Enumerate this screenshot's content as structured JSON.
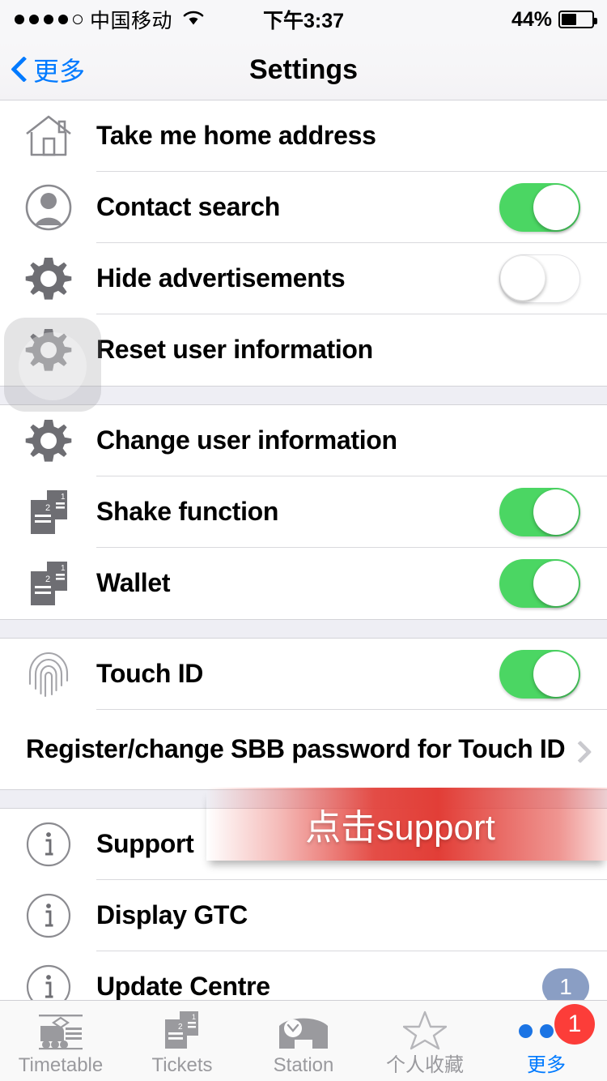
{
  "status_bar": {
    "signal_dots_filled": 4,
    "signal_dots_total": 5,
    "carrier": "中国移动",
    "wifi_icon": "wifi-icon",
    "time": "下午3:37",
    "battery_percent": "44%",
    "battery_level": 44
  },
  "nav": {
    "back_label": "更多",
    "back_icon": "chevron-left-icon",
    "title": "Settings"
  },
  "sections": [
    {
      "rows": [
        {
          "icon": "home-icon",
          "label": "Take me home address",
          "control": "none"
        },
        {
          "icon": "contact-icon",
          "label": "Contact search",
          "control": "toggle",
          "toggle_on": true
        },
        {
          "icon": "gear-icon",
          "label": "Hide advertisements",
          "control": "toggle",
          "toggle_on": false
        },
        {
          "icon": "gear-icon",
          "label": "Reset user information",
          "control": "none",
          "highlighted": true
        }
      ]
    },
    {
      "rows": [
        {
          "icon": "gear-icon",
          "label": "Change user information",
          "control": "none"
        },
        {
          "icon": "ticket-icon",
          "label": "Shake function",
          "control": "toggle",
          "toggle_on": true
        },
        {
          "icon": "ticket-icon",
          "label": "Wallet",
          "control": "toggle",
          "toggle_on": true
        }
      ]
    },
    {
      "rows": [
        {
          "icon": "fingerprint-icon",
          "label": "Touch ID",
          "control": "toggle",
          "toggle_on": true
        },
        {
          "icon": "none",
          "label": "Register/change SBB password for Touch ID",
          "control": "chevron"
        }
      ]
    },
    {
      "rows": [
        {
          "icon": "info-icon",
          "label": "Support",
          "control": "none"
        },
        {
          "icon": "info-icon",
          "label": "Display GTC",
          "control": "none"
        },
        {
          "icon": "info-icon",
          "label": "Update Centre",
          "control": "badge",
          "badge": "1"
        }
      ]
    }
  ],
  "annotation": {
    "text": "点击support",
    "color": "#e23e37"
  },
  "colors": {
    "toggle_on": "#4bd663",
    "accent_blue": "#007aff",
    "badge_blue_grey": "#8a9ec4",
    "badge_red": "#fc3d39",
    "section_gap": "#eeeef4"
  },
  "tabbar": {
    "items": [
      {
        "icon": "train-icon",
        "label": "Timetable",
        "active": false
      },
      {
        "icon": "ticket-icon",
        "label": "Tickets",
        "active": false
      },
      {
        "icon": "station-icon",
        "label": "Station",
        "active": false
      },
      {
        "icon": "star-icon",
        "label": "个人收藏",
        "active": false
      },
      {
        "icon": "more-dots-icon",
        "label": "更多",
        "active": true,
        "badge": "1"
      }
    ]
  }
}
